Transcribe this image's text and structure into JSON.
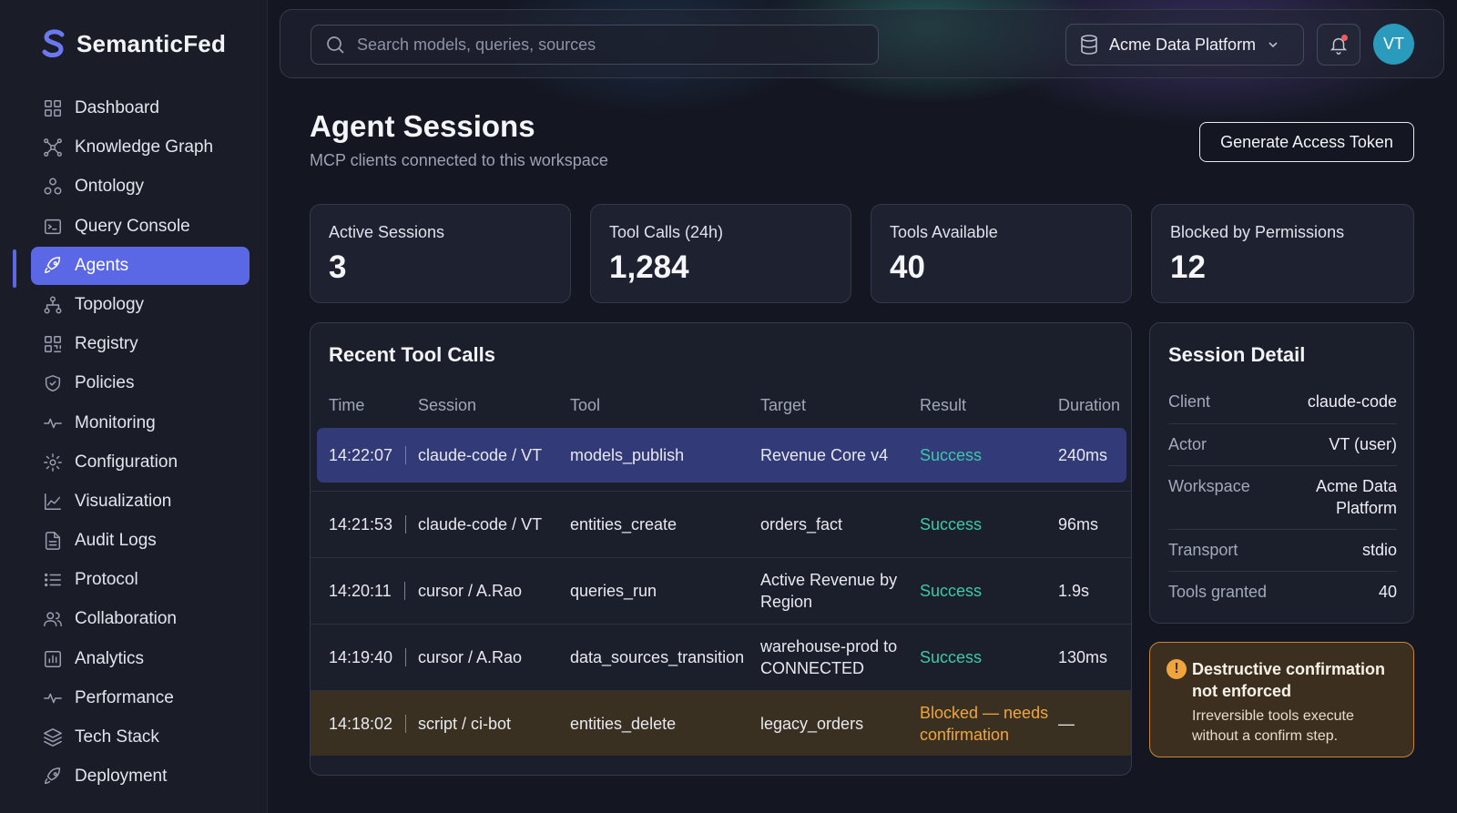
{
  "brand": {
    "name": "SemanticFed",
    "accent": "#5b68e6"
  },
  "sidebar": {
    "items": [
      {
        "label": "Dashboard",
        "icon": "grid-icon"
      },
      {
        "label": "Knowledge Graph",
        "icon": "graph-icon"
      },
      {
        "label": "Ontology",
        "icon": "ontology-icon"
      },
      {
        "label": "Query Console",
        "icon": "terminal-icon"
      },
      {
        "label": "Agents",
        "icon": "rocket-icon",
        "active": true
      },
      {
        "label": "Topology",
        "icon": "topology-icon"
      },
      {
        "label": "Registry",
        "icon": "registry-icon"
      },
      {
        "label": "Policies",
        "icon": "shield-check-icon"
      },
      {
        "label": "Monitoring",
        "icon": "activity-icon"
      },
      {
        "label": "Configuration",
        "icon": "gear-icon"
      },
      {
        "label": "Visualization",
        "icon": "line-chart-icon"
      },
      {
        "label": "Audit Logs",
        "icon": "file-text-icon"
      },
      {
        "label": "Protocol",
        "icon": "list-icon"
      },
      {
        "label": "Collaboration",
        "icon": "users-icon"
      },
      {
        "label": "Analytics",
        "icon": "bar-chart-icon"
      },
      {
        "label": "Performance",
        "icon": "pulse-icon"
      },
      {
        "label": "Tech Stack",
        "icon": "layers-icon"
      },
      {
        "label": "Deployment",
        "icon": "rocket-icon"
      }
    ]
  },
  "topbar": {
    "search_placeholder": "Search models, queries, sources",
    "workspace": "Acme Data Platform",
    "avatar_initials": "VT"
  },
  "page": {
    "title": "Agent Sessions",
    "subtitle": "MCP clients connected to this workspace",
    "token_button": "Generate Access Token"
  },
  "stats": [
    {
      "label": "Active Sessions",
      "value": "3"
    },
    {
      "label": "Tool Calls (24h)",
      "value": "1,284"
    },
    {
      "label": "Tools Available",
      "value": "40"
    },
    {
      "label": "Blocked by Permissions",
      "value": "12"
    }
  ],
  "tool_calls": {
    "title": "Recent Tool Calls",
    "headers": [
      "Time",
      "Session",
      "Tool",
      "Target",
      "Result",
      "Duration"
    ],
    "rows": [
      {
        "time": "14:22:07",
        "session": "claude-code / VT",
        "tool": "models_publish",
        "target": "Revenue Core v4",
        "result": "Success",
        "duration": "240ms"
      },
      {
        "time": "14:21:53",
        "session": "claude-code / VT",
        "tool": "entities_create",
        "target": "orders_fact",
        "result": "Success",
        "duration": "96ms"
      },
      {
        "time": "14:20:11",
        "session": "cursor / A.Rao",
        "tool": "queries_run",
        "target": "Active Revenue by Region",
        "result": "Success",
        "duration": "1.9s"
      },
      {
        "time": "14:19:40",
        "session": "cursor / A.Rao",
        "tool": "data_sources_transition",
        "target": "warehouse-prod to CONNECTED",
        "result": "Success",
        "duration": "130ms"
      },
      {
        "time": "14:18:02",
        "session": "script / ci-bot",
        "tool": "entities_delete",
        "target": "legacy_orders",
        "result": "Blocked — needs confirmation",
        "duration": "—"
      }
    ]
  },
  "session_detail": {
    "title": "Session Detail",
    "fields": [
      {
        "key": "Client",
        "value": "claude-code"
      },
      {
        "key": "Actor",
        "value": "VT (user)"
      },
      {
        "key": "Workspace",
        "value": "Acme Data Platform"
      },
      {
        "key": "Transport",
        "value": "stdio"
      },
      {
        "key": "Tools granted",
        "value": "40"
      }
    ]
  },
  "alert": {
    "title": "Destructive confirmation not enforced",
    "body": "Irreversible tools execute without a confirm step.",
    "color": "#f0a53c"
  }
}
